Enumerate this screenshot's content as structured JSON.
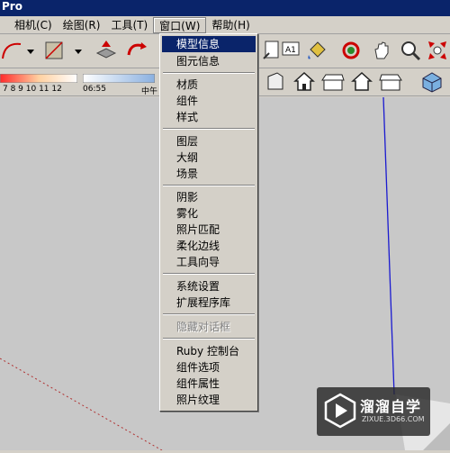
{
  "window": {
    "title_fragment": "Pro"
  },
  "menubar": {
    "items": [
      {
        "label": "相机(C)"
      },
      {
        "label": "绘图(R)"
      },
      {
        "label": "工具(T)"
      },
      {
        "label": "窗口(W)"
      },
      {
        "label": "帮助(H)"
      }
    ]
  },
  "shadow_bar": {
    "months": "7  8  9  10 11 12",
    "time": "06:55",
    "noon": "中午"
  },
  "window_menu": {
    "items": [
      {
        "label": "模型信息"
      },
      {
        "label": "图元信息"
      },
      {
        "label": "材质"
      },
      {
        "label": "组件"
      },
      {
        "label": "样式"
      },
      {
        "label": "图层"
      },
      {
        "label": "大纲"
      },
      {
        "label": "场景"
      },
      {
        "label": "阴影"
      },
      {
        "label": "雾化"
      },
      {
        "label": "照片匹配"
      },
      {
        "label": "柔化边线"
      },
      {
        "label": "工具向导"
      },
      {
        "label": "系统设置"
      },
      {
        "label": "扩展程序库"
      },
      {
        "label": "隐藏对话框"
      },
      {
        "label": "Ruby 控制台"
      },
      {
        "label": "组件选项"
      },
      {
        "label": "组件属性"
      },
      {
        "label": "照片纹理"
      }
    ]
  },
  "watermark": {
    "brand": "溜溜自学",
    "url": "ZIXUE.3D66.COM"
  },
  "colors": {
    "menu_highlight": "#0a246a",
    "axis_blue": "#1a1ad0",
    "axis_red": "#b03030"
  }
}
